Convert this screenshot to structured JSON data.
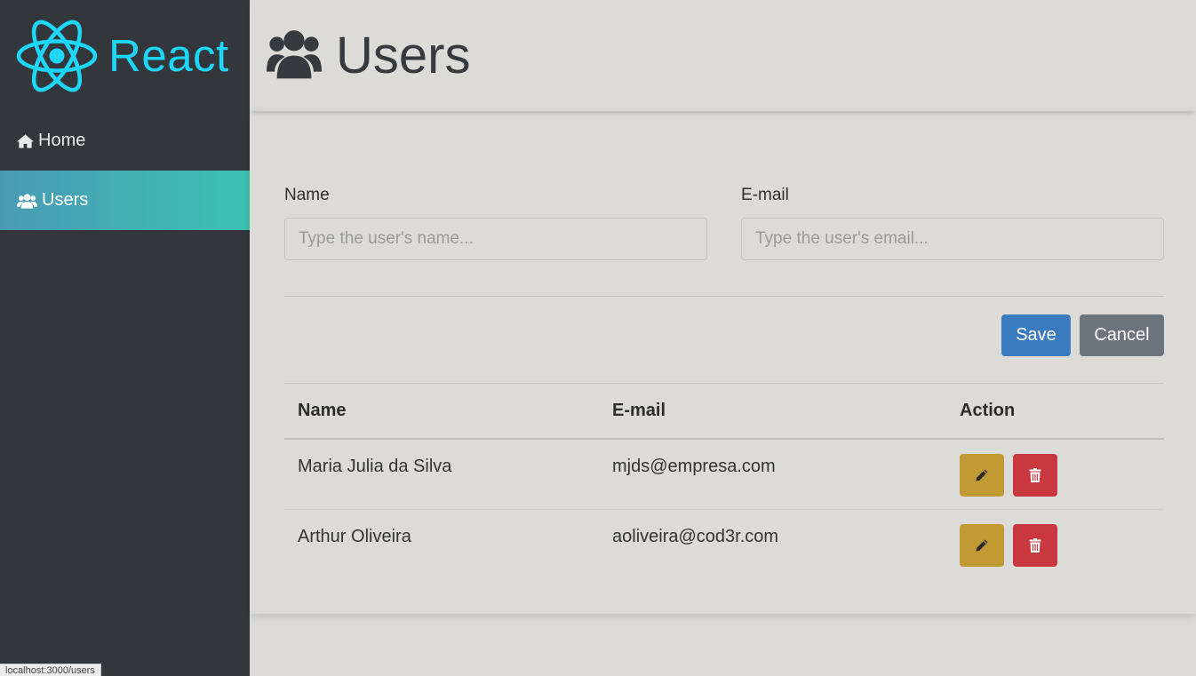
{
  "brand": {
    "logo_text": "React",
    "color": "#1ed6f7"
  },
  "sidebar": {
    "items": [
      {
        "label": "Home",
        "icon": "home-icon",
        "active": false
      },
      {
        "label": "Users",
        "icon": "users-icon",
        "active": true
      }
    ]
  },
  "header": {
    "title": "Users",
    "icon": "users-icon"
  },
  "form": {
    "name_label": "Name",
    "name_placeholder": "Type the user's name...",
    "name_value": "",
    "email_label": "E-mail",
    "email_placeholder": "Type the user's email...",
    "email_value": ""
  },
  "buttons": {
    "save_label": "Save",
    "cancel_label": "Cancel"
  },
  "table": {
    "headers": [
      "Name",
      "E-mail",
      "Action"
    ],
    "rows": [
      {
        "name": "Maria Julia da Silva",
        "email": "mjds@empresa.com",
        "actions": [
          "pencil-icon",
          "trash-icon"
        ]
      },
      {
        "name": "Arthur Oliveira",
        "email": "aoliveira@cod3r.com",
        "actions": [
          "pencil-icon",
          "trash-icon"
        ]
      }
    ]
  },
  "status_bar": {
    "url": "localhost:3000/users"
  },
  "colors": {
    "sidebar_bg": "#33373b",
    "save": "#3b7bbf",
    "cancel": "#6c757d",
    "edit": "#c29a33",
    "delete": "#c9373f"
  }
}
